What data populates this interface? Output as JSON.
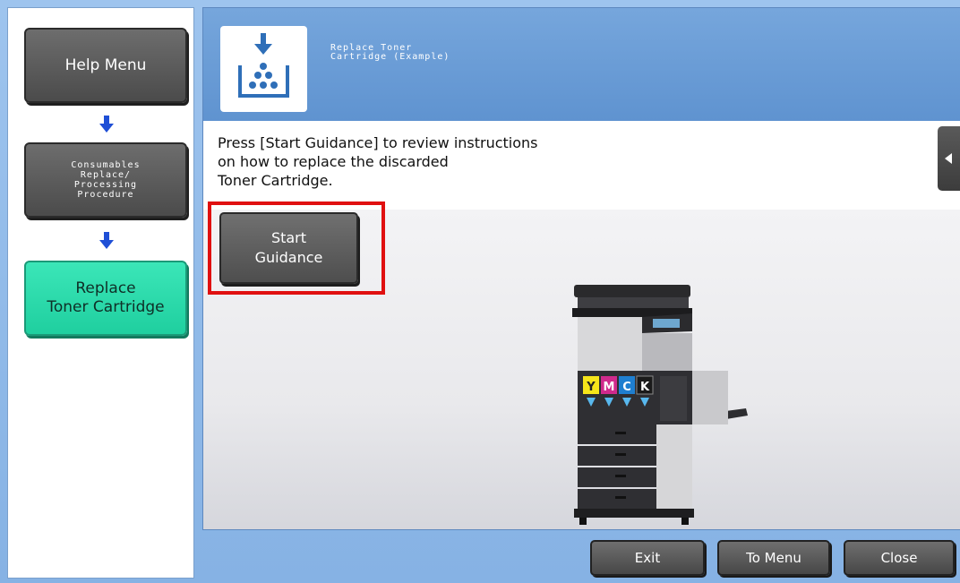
{
  "nav": {
    "help_menu": "Help Menu",
    "consumables": "Consumables\nReplace/\nProcessing\nProcedure",
    "replace_toner": "Replace\nToner Cartridge"
  },
  "header": {
    "title": "Replace Toner\nCartridge (Example)"
  },
  "main": {
    "instructions": "Press [Start Guidance] to review instructions\non how to replace the discarded\nToner Cartridge.",
    "start_guidance": "Start\nGuidance"
  },
  "printer": {
    "toner_labels": [
      "Y",
      "M",
      "C",
      "K"
    ]
  },
  "footer": {
    "exit": "Exit",
    "to_menu": "To Menu",
    "close": "Close"
  },
  "colors": {
    "accent": "#1fcf9f",
    "header": "#6a9dd6",
    "highlight": "#e01010"
  }
}
